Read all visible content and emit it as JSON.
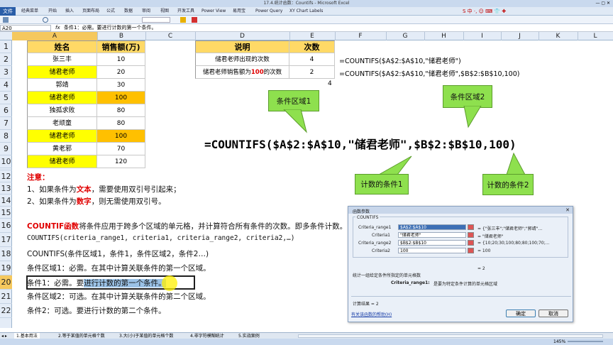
{
  "window": {
    "title": "17.4.统计函数：Countifs - Microsoft Excel"
  },
  "menu": {
    "file": "文件",
    "items": [
      "经典菜单",
      "开始",
      "插入",
      "页面布局",
      "公式",
      "数据",
      "审阅",
      "视图",
      "开发工具",
      "Power View",
      "易用宝",
      "Power Query",
      "XY Chart Labels"
    ],
    "ime": "S 中 ·, ☺ ⌨ 👕 ✚"
  },
  "formula_bar": {
    "name_box": "A20",
    "fx": "fx",
    "content": "条件1：必需。要进行计数的第一个条件。"
  },
  "columns": [
    "A",
    "B",
    "C",
    "D",
    "E",
    "F",
    "G",
    "H",
    "I",
    "J",
    "K",
    "L"
  ],
  "rows": [
    "1",
    "2",
    "3",
    "4",
    "5",
    "6",
    "7",
    "8",
    "9",
    "10",
    "11",
    "12",
    "13",
    "14",
    "15",
    "16",
    "17",
    "18",
    "19",
    "20",
    "21",
    "22"
  ],
  "table1": {
    "headers": [
      "姓名",
      "销售额(万)"
    ],
    "rows": [
      {
        "name": "张三丰",
        "value": "10",
        "highlight": "none"
      },
      {
        "name": "储君老师",
        "value": "20",
        "highlight": "yellow"
      },
      {
        "name": "郭靖",
        "value": "30",
        "highlight": "none"
      },
      {
        "name": "储君老师",
        "value": "100",
        "highlight": "orange"
      },
      {
        "name": "独孤求败",
        "value": "80",
        "highlight": "none"
      },
      {
        "name": "老顽童",
        "value": "80",
        "highlight": "none"
      },
      {
        "name": "储君老师",
        "value": "100",
        "highlight": "orange"
      },
      {
        "name": "黄老邪",
        "value": "70",
        "highlight": "none"
      },
      {
        "name": "储君老师",
        "value": "120",
        "highlight": "yellow"
      }
    ]
  },
  "table2": {
    "headers": [
      "说明",
      "次数"
    ],
    "rows": [
      {
        "desc": "储君老师出现的次数",
        "count": "4",
        "formula": "=COUNTIFS($A$2:$A$10,\"储君老师\")"
      },
      {
        "desc_pre": "储君老师销售额为",
        "desc_red": "100",
        "desc_post": "的次数",
        "count": "2",
        "formula": "=COUNTIFS($A$2:$A$10,\"储君老师\",$B$2:$B$10,100)"
      }
    ],
    "stray_value": "4"
  },
  "big_formula": "=COUNTIFS($A$2:$A$10,\"储君老师\",$B$2:$B$10,100)",
  "callouts": {
    "range1": "条件区域1",
    "range2": "条件区域2",
    "crit1": "计数的条件1",
    "crit2": "计数的条件2"
  },
  "notes": {
    "title": "注意：",
    "line13_pre": "1、如果条件为",
    "line13_red": "文本",
    "line13_post": "，需要使用双引号引起来；",
    "line14_pre": "2、如果条件为",
    "line14_red": "数字",
    "line14_post": "，则无需使用双引号。",
    "line16_red": "COUNTIF函数",
    "line16_post": "将条件应用于跨多个区域的单元格，并计算符合所有条件的次数。即多条件计数。",
    "line17": "COUNTIFS(criteria_range1, criteria1, criteria_range2, criteria2,…)",
    "line18": "COUNTIFS(条件区域1，条件1，条件区域2，条件2…)",
    "line19": "条件区域1：必需。在其中计算关联条件的第一个区域。",
    "line20_pre": "条件1：必需。要",
    "line20_sel": "进行计数的第一个条件。",
    "line21": "条件区域2：可选。在其中计算关联条件的第二个区域。",
    "line22": "条件2：可选。要进行计数的第二个条件。"
  },
  "dialog": {
    "title": "函数参数",
    "fn": "COUNTIFS",
    "args": [
      {
        "label": "Criteria_range1",
        "value": "$A$2:$A$10",
        "result": "= {\"张三丰\";\"储君老师\";\"郭靖\"…"
      },
      {
        "label": "Criteria1",
        "value": "\"储君老师\"",
        "result": "= \"储君老师\""
      },
      {
        "label": "Criteria_range2",
        "value": "$B$2:$B$10",
        "result": "= {10;20;30;100;80;80;100;70;…"
      },
      {
        "label": "Criteria2",
        "value": "100",
        "result": "= 100"
      }
    ],
    "eq_result": "= 2",
    "desc": "统计一组给定条件所指定的单元格数",
    "arg_desc_label": "Criteria_range1:",
    "arg_desc": "是要为特定条件计算的单元格区域",
    "calc_result": "计算结果 = 2",
    "help_link": "有关该函数的帮助(H)",
    "ok": "确定",
    "cancel": "取消"
  },
  "sheet_tabs": [
    "1.基本用法",
    "2.等于某值的单元格个数",
    "3.大(小)于某值的单元格个数",
    "4.非字符模糊统计",
    "5.实战案例"
  ],
  "status": {
    "zoom": "145%"
  },
  "colors": {
    "yellow": "#ffff00",
    "orange": "#ffc000",
    "callout": "#8ee04e",
    "red": "#e00000"
  }
}
